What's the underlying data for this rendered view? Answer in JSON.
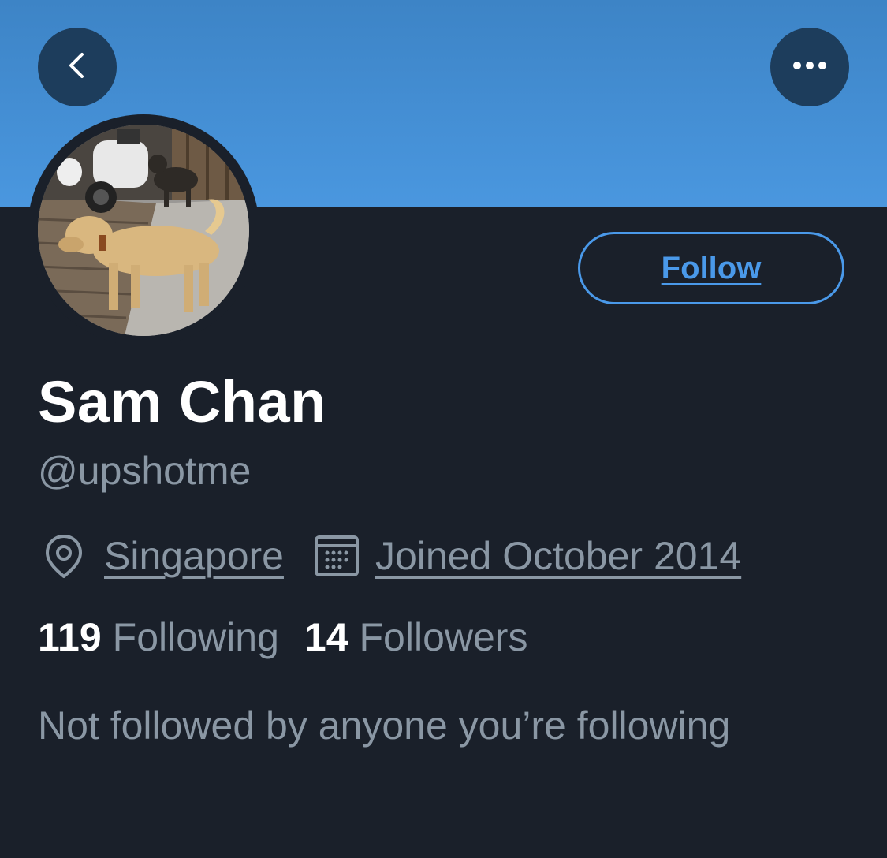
{
  "header": {
    "back_icon": "chevron-left-icon",
    "more_icon": "more-horizontal-icon",
    "banner_color": "#4a97df"
  },
  "actions": {
    "follow_label": "Follow",
    "accent_color": "#4a99e9"
  },
  "profile": {
    "display_name": "Sam Chan",
    "handle": "@upshotme",
    "location": "Singapore",
    "location_icon": "location-pin-icon",
    "joined": "Joined October 2014",
    "joined_icon": "calendar-icon",
    "following_count": "119",
    "following_label": "Following",
    "followers_count": "14",
    "followers_label": "Followers",
    "mutuals_text": "Not followed by anyone you’re following"
  }
}
